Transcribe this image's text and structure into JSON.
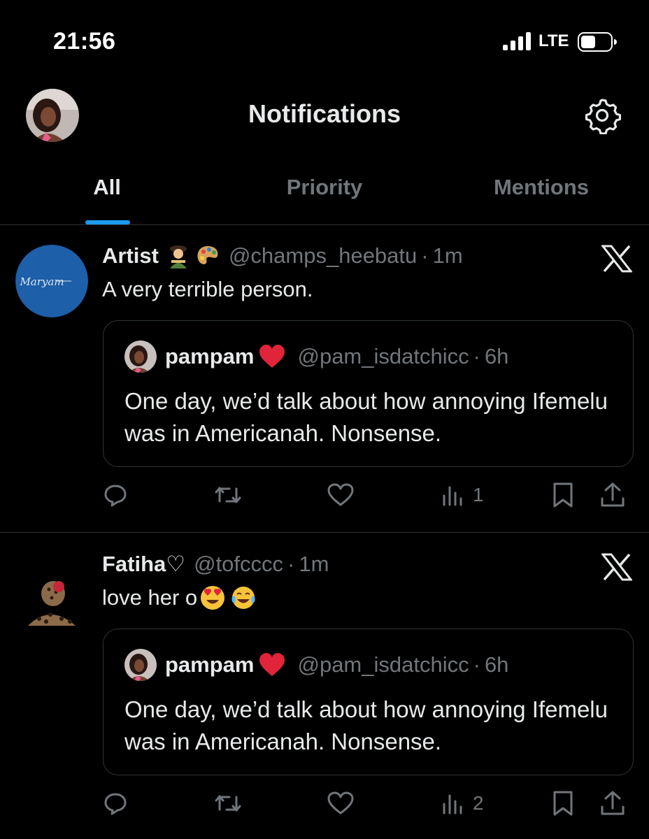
{
  "status_bar": {
    "time": "21:56",
    "network": "LTE"
  },
  "header": {
    "title": "Notifications"
  },
  "tabs": [
    {
      "label": "All",
      "active": true
    },
    {
      "label": "Priority",
      "active": false
    },
    {
      "label": "Mentions",
      "active": false
    }
  ],
  "notifications": [
    {
      "name": "Artist",
      "name_emojis": [
        "artist-emoji",
        "palette-emoji"
      ],
      "handle": "@champs_heebatu",
      "separator": "·",
      "time": "1m",
      "text": "A very terrible person.",
      "avatar_logo_text": "Maryam",
      "quote": {
        "name": "pampam",
        "name_emoji": "red-heart-emoji",
        "handle": "@pam_isdatchicc",
        "separator": "·",
        "time": "6h",
        "text": "One day, we’d talk about how annoying Ifemelu was in Americanah. Nonsense."
      },
      "views": "1"
    },
    {
      "name": "Fatiha♡",
      "handle": "@tofcccc",
      "separator": "·",
      "time": "1m",
      "text": "love her o",
      "text_emojis": [
        "heart-eyes-emoji",
        "tears-of-joy-emoji"
      ],
      "quote": {
        "name": "pampam",
        "name_emoji": "red-heart-emoji",
        "handle": "@pam_isdatchicc",
        "separator": "·",
        "time": "6h",
        "text": "One day, we’d talk about how annoying Ifemelu was in Americanah. Nonsense."
      },
      "views": "2"
    }
  ],
  "colors": {
    "background": "#000000",
    "text_primary": "#e7e9ea",
    "text_secondary": "#71767b",
    "accent": "#1d9bf0",
    "divider": "#2f3336"
  },
  "icons": [
    "settings-gear-icon",
    "x-logo-icon",
    "reply-icon",
    "retweet-icon",
    "like-icon",
    "views-icon",
    "bookmark-icon",
    "share-icon"
  ]
}
